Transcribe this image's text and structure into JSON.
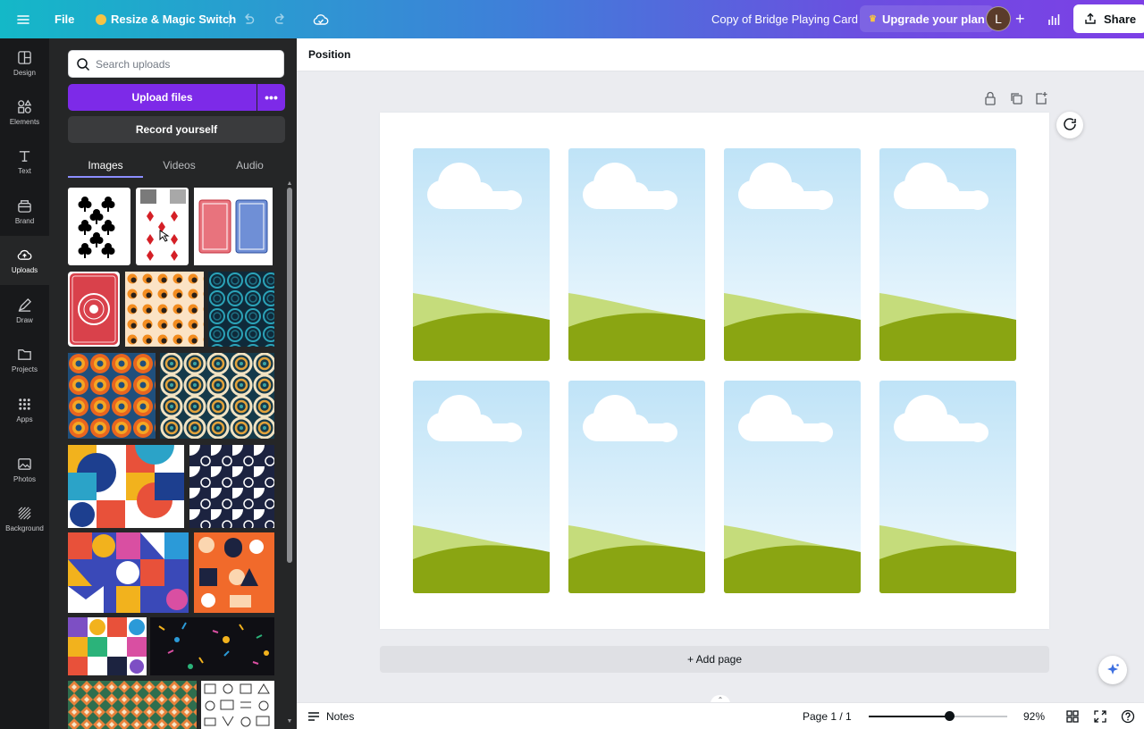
{
  "topbar": {
    "file": "File",
    "resize": "Resize & Magic Switch",
    "doc_title": "Copy of Bridge Playing Card",
    "upgrade": "Upgrade your plan",
    "avatar_initial": "L",
    "share": "Share"
  },
  "rail": {
    "items": [
      {
        "label": "Design",
        "icon": "layout-icon"
      },
      {
        "label": "Elements",
        "icon": "shapes-icon"
      },
      {
        "label": "Text",
        "icon": "text-icon"
      },
      {
        "label": "Brand",
        "icon": "brand-icon"
      },
      {
        "label": "Uploads",
        "icon": "cloud-upload-icon",
        "active": true
      },
      {
        "label": "Draw",
        "icon": "pen-icon"
      },
      {
        "label": "Projects",
        "icon": "folder-icon"
      },
      {
        "label": "Apps",
        "icon": "apps-grid-icon"
      },
      {
        "label": "Photos",
        "icon": "photo-icon"
      },
      {
        "label": "Background",
        "icon": "background-pattern-icon"
      }
    ]
  },
  "panel": {
    "search_placeholder": "Search uploads",
    "upload_label": "Upload files",
    "record_label": "Record yourself",
    "tabs": [
      "Images",
      "Videos",
      "Audio"
    ],
    "active_tab": "Images"
  },
  "context": {
    "position": "Position"
  },
  "canvas": {
    "add_page": "+ Add page",
    "card_count": 8
  },
  "bottombar": {
    "notes": "Notes",
    "page_indicator": "Page 1 / 1",
    "zoom": "92%",
    "zoom_fraction": 0.58
  },
  "colors": {
    "accent_purple": "#7d2ae8",
    "rail_bg": "#18191b",
    "panel_bg": "#252627",
    "sky_top": "#bfe3f7",
    "grass_dark": "#8aa512",
    "grass_light": "#c5dc7b"
  }
}
